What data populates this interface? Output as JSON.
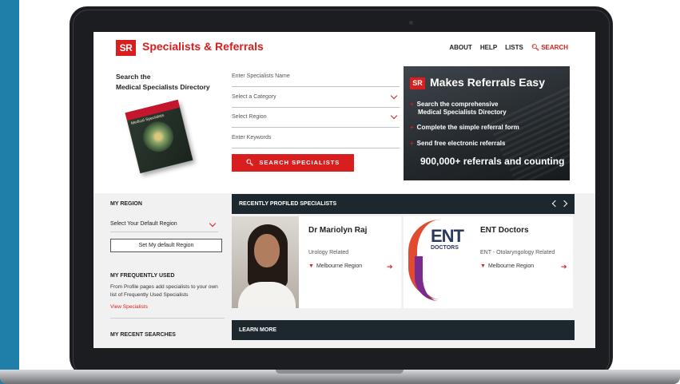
{
  "header": {
    "logo_text": "SR",
    "brand": "Specialists & Referrals",
    "nav": [
      "ABOUT",
      "HELP",
      "LISTS"
    ],
    "search_link": "SEARCH"
  },
  "search": {
    "title_line1": "Search the",
    "title_line2": "Medical Specialists Directory",
    "book_title": "Medical Specialists",
    "name_placeholder": "Enter Specialists Name",
    "category_placeholder": "Select a Category",
    "region_placeholder": "Select Region",
    "keywords_placeholder": "Enter Keywords",
    "button": "SEARCH SPECIALISTS"
  },
  "promo": {
    "logo_text": "SR",
    "headline": "Makes Referrals Easy",
    "item1_line1": "Search the comprehensive",
    "item1_line2": "Medical Specialists Directory",
    "item2": "Complete the simple referral form",
    "item3": "Send free electronic referrals",
    "big": "900,000+ referrals and counting",
    "plus": "+"
  },
  "sidebar": {
    "region_heading": "MY REGION",
    "region_select": "Select Your Default Region",
    "set_button": "Set My default Region",
    "frequent_heading": "MY FREQUENTLY USED",
    "frequent_text": "From Profile pages add specialists to your own list of Frequently Used Specialists",
    "view_link": "View Specialists",
    "recent_heading": "MY RECENT SEARCHES"
  },
  "recent": {
    "title": "RECENTLY PROFILED SPECIALISTS",
    "cards": [
      {
        "name": "Dr Mariolyn Raj",
        "category": "Urology Related",
        "location": "Melbourne Region"
      },
      {
        "name": "ENT Doctors",
        "category": "ENT - Otolaryngology Related",
        "location": "Melbourne Region",
        "logo_word": "ENT",
        "logo_sub": "DOCTORS"
      }
    ]
  },
  "learn_more": "LEARN MORE",
  "colors": {
    "brand_red": "#d81e1e",
    "dark_bar": "#1d272e",
    "stripe_blue": "#1f7fa8"
  }
}
